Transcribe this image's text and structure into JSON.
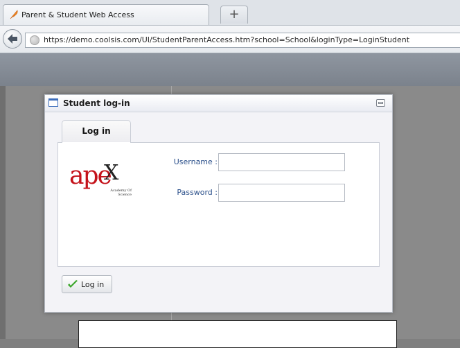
{
  "browser": {
    "tab_title": "Parent & Student Web Access",
    "new_tab_label": "+",
    "url": "https://demo.coolsis.com/UI/StudentParentAccess.htm?school=School&loginType=LoginStudent"
  },
  "dialog": {
    "title": "Student log-in",
    "tab_label": "Log in",
    "logo": {
      "word": "ape",
      "x": "X",
      "subtitle": "Academy Of Science"
    },
    "username_label": "Username :",
    "username_value": "",
    "password_label": "Password :",
    "password_value": "",
    "login_button_label": "Log in"
  },
  "colors": {
    "logo_red": "#c4121a",
    "label_blue": "#2a4f8a",
    "check_green": "#3aa62a"
  }
}
